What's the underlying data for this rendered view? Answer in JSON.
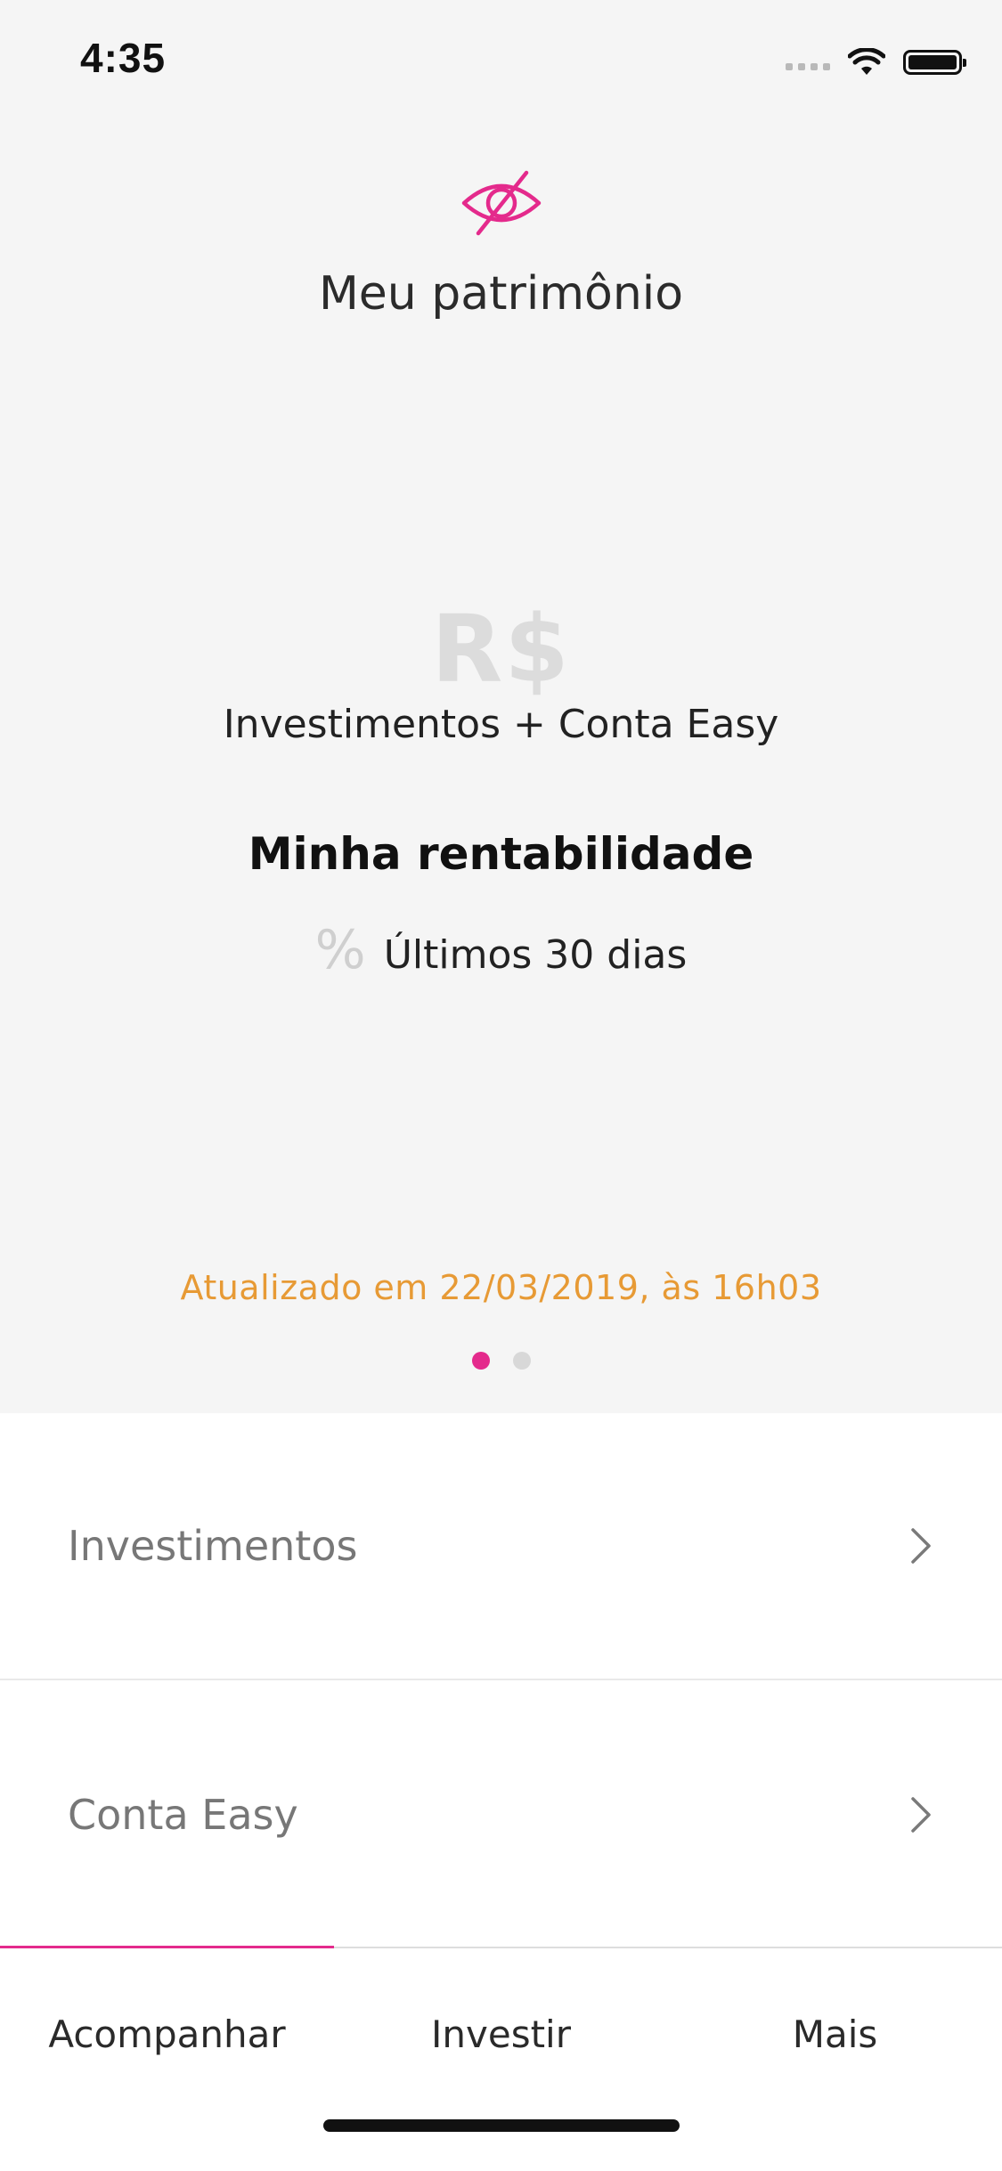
{
  "status_bar": {
    "time": "4:35"
  },
  "hero": {
    "title": "Meu patrimônio",
    "currency_symbol": "R$",
    "subtitle": "Investimentos + Conta Easy",
    "rentabilidade_heading": "Minha rentabilidade",
    "percent_symbol": "%",
    "period_label": "Últimos 30 dias",
    "updated_text": "Atualizado em 22/03/2019, às 16h03",
    "pagination": {
      "current": 1,
      "total": 2
    }
  },
  "list": {
    "items": [
      {
        "label": "Investimentos"
      },
      {
        "label": "Conta Easy"
      }
    ]
  },
  "tabbar": {
    "tabs": [
      {
        "label": "Acompanhar",
        "active": true
      },
      {
        "label": "Investir",
        "active": false
      },
      {
        "label": "Mais",
        "active": false
      }
    ]
  },
  "colors": {
    "accent": "#e42a8c",
    "updated_text": "#e79a35",
    "hero_background": "#f5f5f5"
  },
  "icons": {
    "visibility_toggle": "eye-off-icon",
    "list_chevron": "chevron-right-icon"
  }
}
